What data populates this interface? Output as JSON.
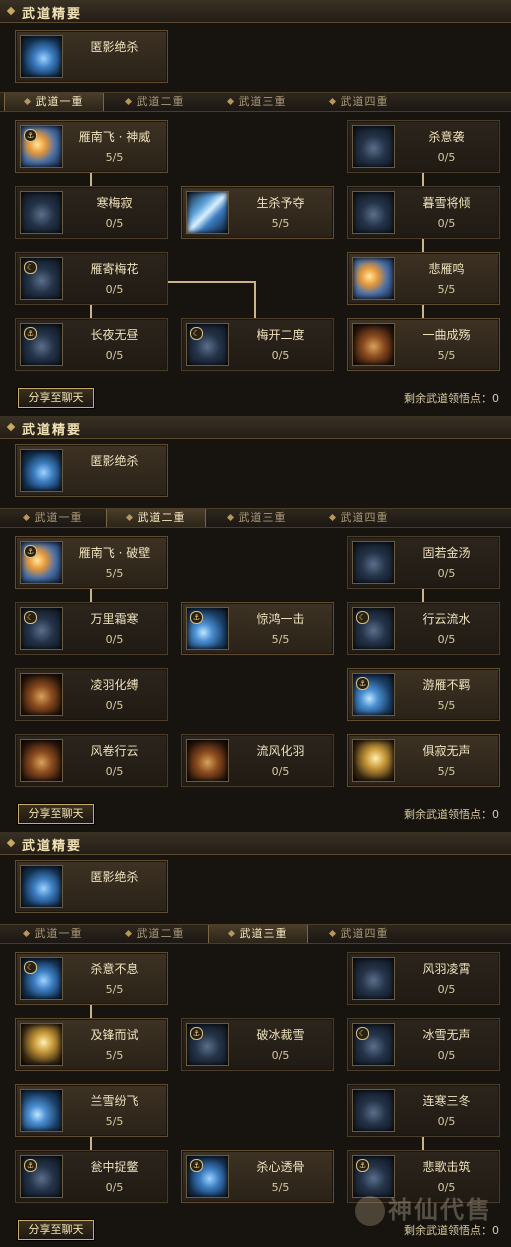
{
  "section_title": "武道精要",
  "passive_skill": "匿影绝杀",
  "tabs": [
    "武道一重",
    "武道二重",
    "武道三重",
    "武道四重"
  ],
  "share_label": "分享至聊天",
  "remain_label": "剩余武道领悟点：0",
  "panels": [
    {
      "active_tab": 0,
      "cards": [
        {
          "name": "雁南飞 · 神威",
          "level": "5/5"
        },
        {
          "name": "杀意袭",
          "level": "0/5"
        },
        {
          "name": "寒梅寂",
          "level": "0/5"
        },
        {
          "name": "生杀予夺",
          "level": "5/5"
        },
        {
          "name": "暮雪将倾",
          "level": "0/5"
        },
        {
          "name": "雁寄梅花",
          "level": "0/5"
        },
        {
          "name": "悲雁鸣",
          "level": "5/5"
        },
        {
          "name": "长夜无昼",
          "level": "0/5"
        },
        {
          "name": "梅开二度",
          "level": "0/5"
        },
        {
          "name": "一曲成殇",
          "level": "5/5"
        }
      ]
    },
    {
      "active_tab": 1,
      "cards": [
        {
          "name": "雁南飞 · 破壁",
          "level": "5/5"
        },
        {
          "name": "固若金汤",
          "level": "0/5"
        },
        {
          "name": "万里霜寒",
          "level": "0/5"
        },
        {
          "name": "惊鸿一击",
          "level": "5/5"
        },
        {
          "name": "行云流水",
          "level": "0/5"
        },
        {
          "name": "凌羽化缚",
          "level": "0/5"
        },
        {
          "name": "游雁不羁",
          "level": "5/5"
        },
        {
          "name": "风卷行云",
          "level": "0/5"
        },
        {
          "name": "流风化羽",
          "level": "0/5"
        },
        {
          "name": "俱寂无声",
          "level": "5/5"
        }
      ]
    },
    {
      "active_tab": 2,
      "cards": [
        {
          "name": "杀意不息",
          "level": "5/5"
        },
        {
          "name": "风羽凌霄",
          "level": "0/5"
        },
        {
          "name": "及锋而试",
          "level": "5/5"
        },
        {
          "name": "破冰裁雪",
          "level": "0/5"
        },
        {
          "name": "冰雪无声",
          "level": "0/5"
        },
        {
          "name": "兰雪纷飞",
          "level": "5/5"
        },
        {
          "name": "连寒三冬",
          "level": "0/5"
        },
        {
          "name": "瓮中捉鳖",
          "level": "0/5"
        },
        {
          "name": "杀心透骨",
          "level": "5/5"
        },
        {
          "name": "悲歌击筑",
          "level": "0/5"
        }
      ]
    }
  ],
  "watermark": "神仙代售"
}
